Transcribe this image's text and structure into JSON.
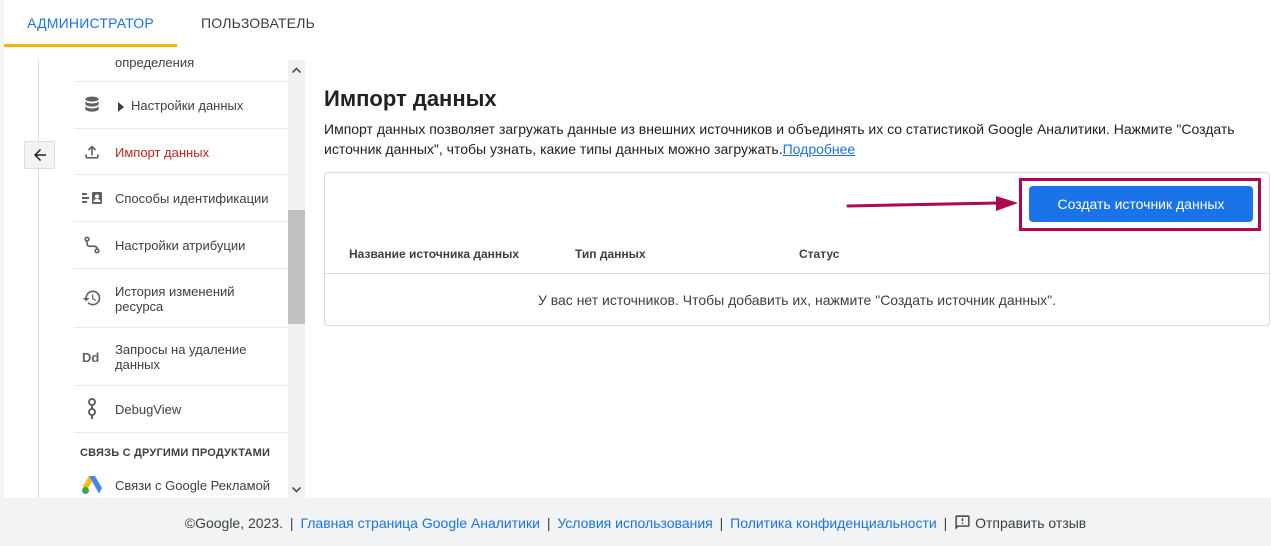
{
  "tabs": {
    "admin": "АДМИНИСТРАТОР",
    "user": "ПОЛЬЗОВАТЕЛЬ"
  },
  "sidebar": {
    "items": [
      {
        "label": "определения",
        "icon": "list-icon"
      },
      {
        "label": "Настройки данных",
        "icon": "database-icon"
      },
      {
        "label": "Импорт данных",
        "icon": "upload-icon",
        "active": true
      },
      {
        "label": "Способы идентификации",
        "icon": "id-icon"
      },
      {
        "label": "Настройки атрибуции",
        "icon": "attribution-icon"
      },
      {
        "label": "История изменений ресурса",
        "icon": "history-icon"
      },
      {
        "label": "Запросы на удаление данных",
        "icon": "dd-icon"
      },
      {
        "label": "DebugView",
        "icon": "debug-icon"
      },
      {
        "label": "Связи с Google Рекламой",
        "icon": "google-ads-icon"
      }
    ],
    "section_title": "СВЯЗЬ С ДРУГИМИ ПРОДУКТАМИ"
  },
  "main": {
    "title": "Импорт данных",
    "description": "Импорт данных позволяет загружать данные из внешних источников и объединять их со статистикой Google Аналитики. Нажмите \"Создать источник данных\", чтобы узнать, какие типы данных можно загружать.",
    "learn_more": "Подробнее",
    "create_button": "Создать источник данных",
    "columns": [
      "Название источника данных",
      "Тип данных",
      "Статус"
    ],
    "empty_message": "У вас нет источников. Чтобы добавить их, нажмите \"Создать источник данных\"."
  },
  "footer": {
    "copyright": "©Google, 2023.",
    "links": [
      "Главная страница Google Аналитики",
      "Условия использования",
      "Политика конфиденциальности"
    ],
    "feedback": "Отправить отзыв"
  },
  "colors": {
    "accent": "#1a73e8",
    "active_item": "#c5221f",
    "tab_indicator": "#f4b400",
    "highlight": "#b0084f"
  }
}
